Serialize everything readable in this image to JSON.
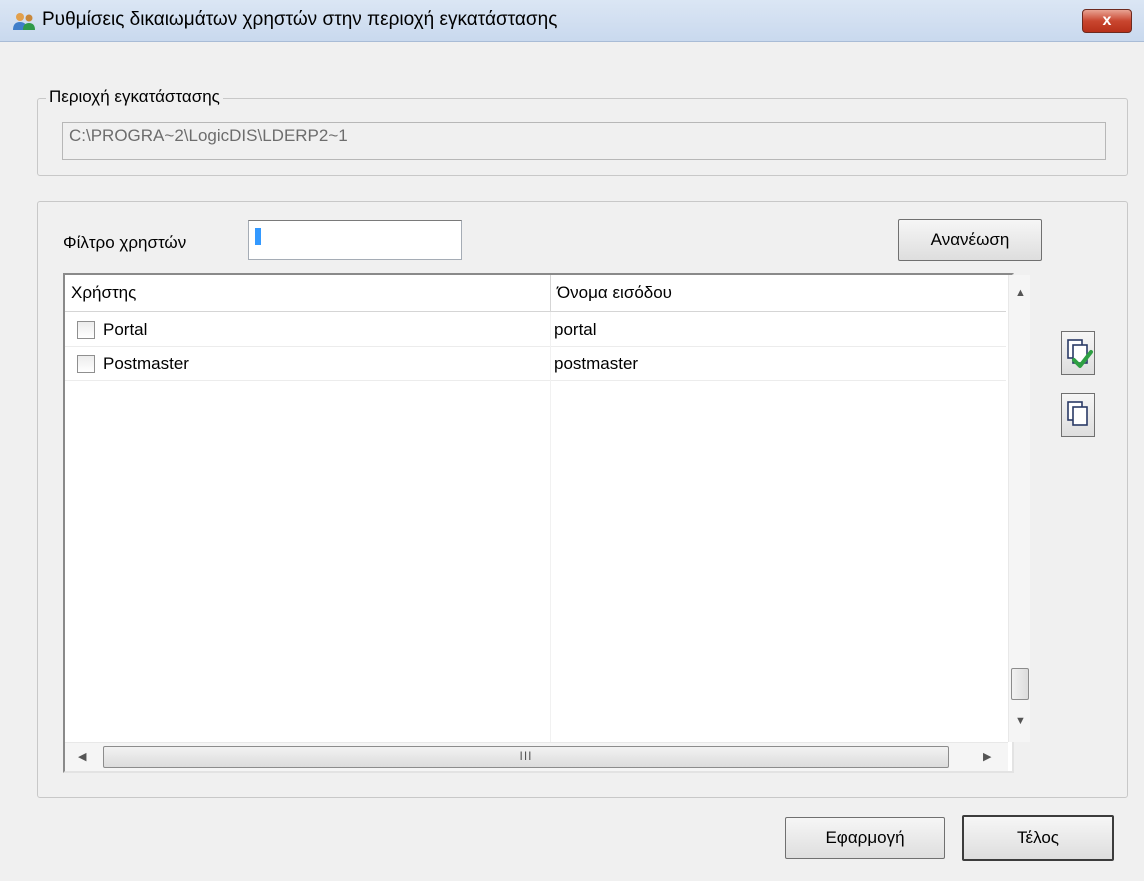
{
  "window": {
    "title": "Ρυθμίσεις δικαιωμάτων χρηστών στην περιοχή εγκατάστασης",
    "close_label": "x"
  },
  "install_area": {
    "legend": "Περιοχή εγκατάστασης",
    "path": "C:\\PROGRA~2\\LogicDIS\\LDERP2~1"
  },
  "filter": {
    "label": "Φίλτρο χρηστών",
    "value": ""
  },
  "refresh_label": "Ανανέωση",
  "grid": {
    "columns": [
      "Χρήστης",
      "Όνομα εισόδου"
    ],
    "rows": [
      {
        "user": "Portal",
        "login": "portal",
        "checked": false
      },
      {
        "user": "Postmaster",
        "login": "postmaster",
        "checked": false
      }
    ],
    "hscroll_grip": "III"
  },
  "side_buttons": {
    "select_all_icon": "select-all-icon",
    "deselect_all_icon": "deselect-all-icon"
  },
  "footer": {
    "apply_label": "Εφαρμογή",
    "finish_label": "Τέλος"
  }
}
